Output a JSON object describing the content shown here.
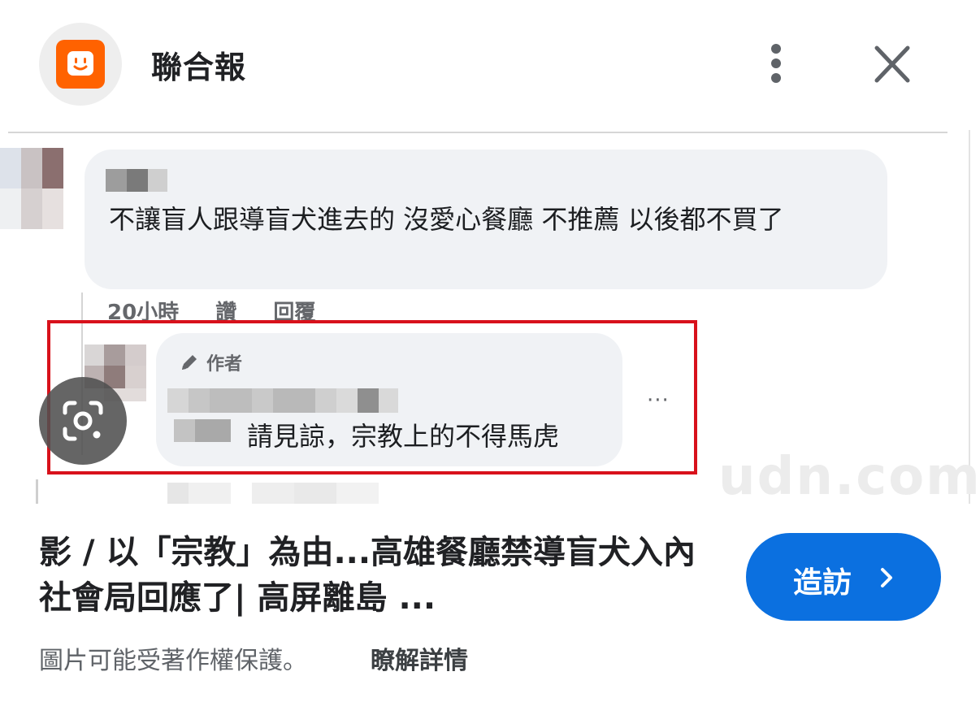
{
  "header": {
    "site_name": "聯合報",
    "logo_color": "#ff6200"
  },
  "preview": {
    "comment": {
      "text": "不讓盲人跟導盲犬進去的 沒愛心餐廳 不推薦 以後都不買了",
      "time": "20小時",
      "like": "讚",
      "reply": "回覆"
    },
    "author_reply": {
      "badge": "作者",
      "text": "請見諒，宗教上的不得馬虎",
      "more": "···"
    },
    "watermark": "udn.com",
    "highlight_color": "#d8111b"
  },
  "article": {
    "title": "影 / 以「宗教」為由...高雄餐廳禁導盲犬入內社會局回應了| 高屏離島 ..."
  },
  "actions": {
    "visit_label": "造訪",
    "visit_color": "#0b70e0"
  },
  "footer": {
    "copyright": "圖片可能受著作權保護。",
    "learn_more": "瞭解詳情"
  },
  "icons": {
    "more": "more-vert-icon",
    "close": "close-icon",
    "lens": "lens-icon",
    "pencil": "pencil-icon",
    "chevron": "chevron-right-icon"
  }
}
